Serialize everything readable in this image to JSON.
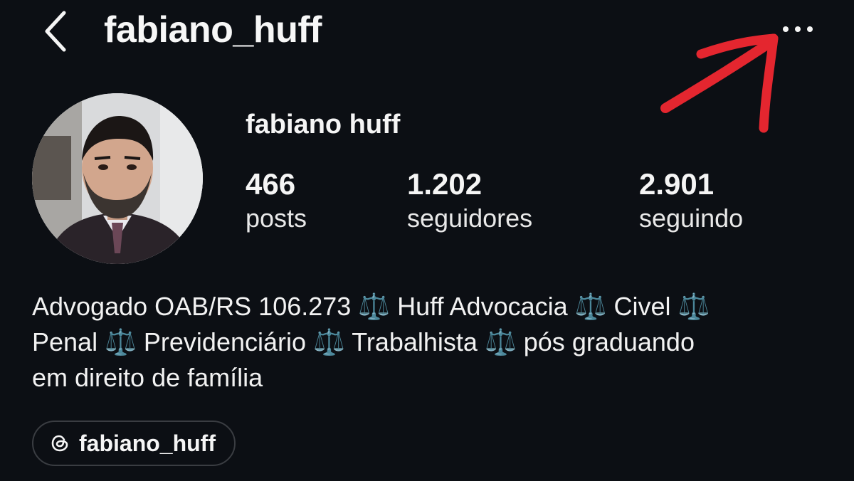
{
  "header": {
    "back_icon": "chevron-left-icon",
    "username": "fabiano_huff",
    "more_icon": "more-horizontal-icon"
  },
  "profile": {
    "display_name": "fabiano huff",
    "avatar_icon": "profile-photo"
  },
  "stats": [
    {
      "value": "466",
      "label": "posts"
    },
    {
      "value": "1.202",
      "label": "seguidores"
    },
    {
      "value": "2.901",
      "label": "seguindo"
    }
  ],
  "bio": {
    "lines": [
      "Advogado OAB/RS 106.273 ⚖️ Huff Advocacia ⚖️ Civel ⚖️",
      "Penal ⚖️ Previdenciário ⚖️ Trabalhista ⚖️ pós graduando",
      "em direito de família"
    ]
  },
  "threads_link": {
    "icon": "threads-icon",
    "label": "fabiano_huff"
  },
  "colors": {
    "background": "#0c0f14",
    "text": "#f5f5f5",
    "annotation_arrow": "#e4262f",
    "chip_border": "#3a3d42"
  }
}
